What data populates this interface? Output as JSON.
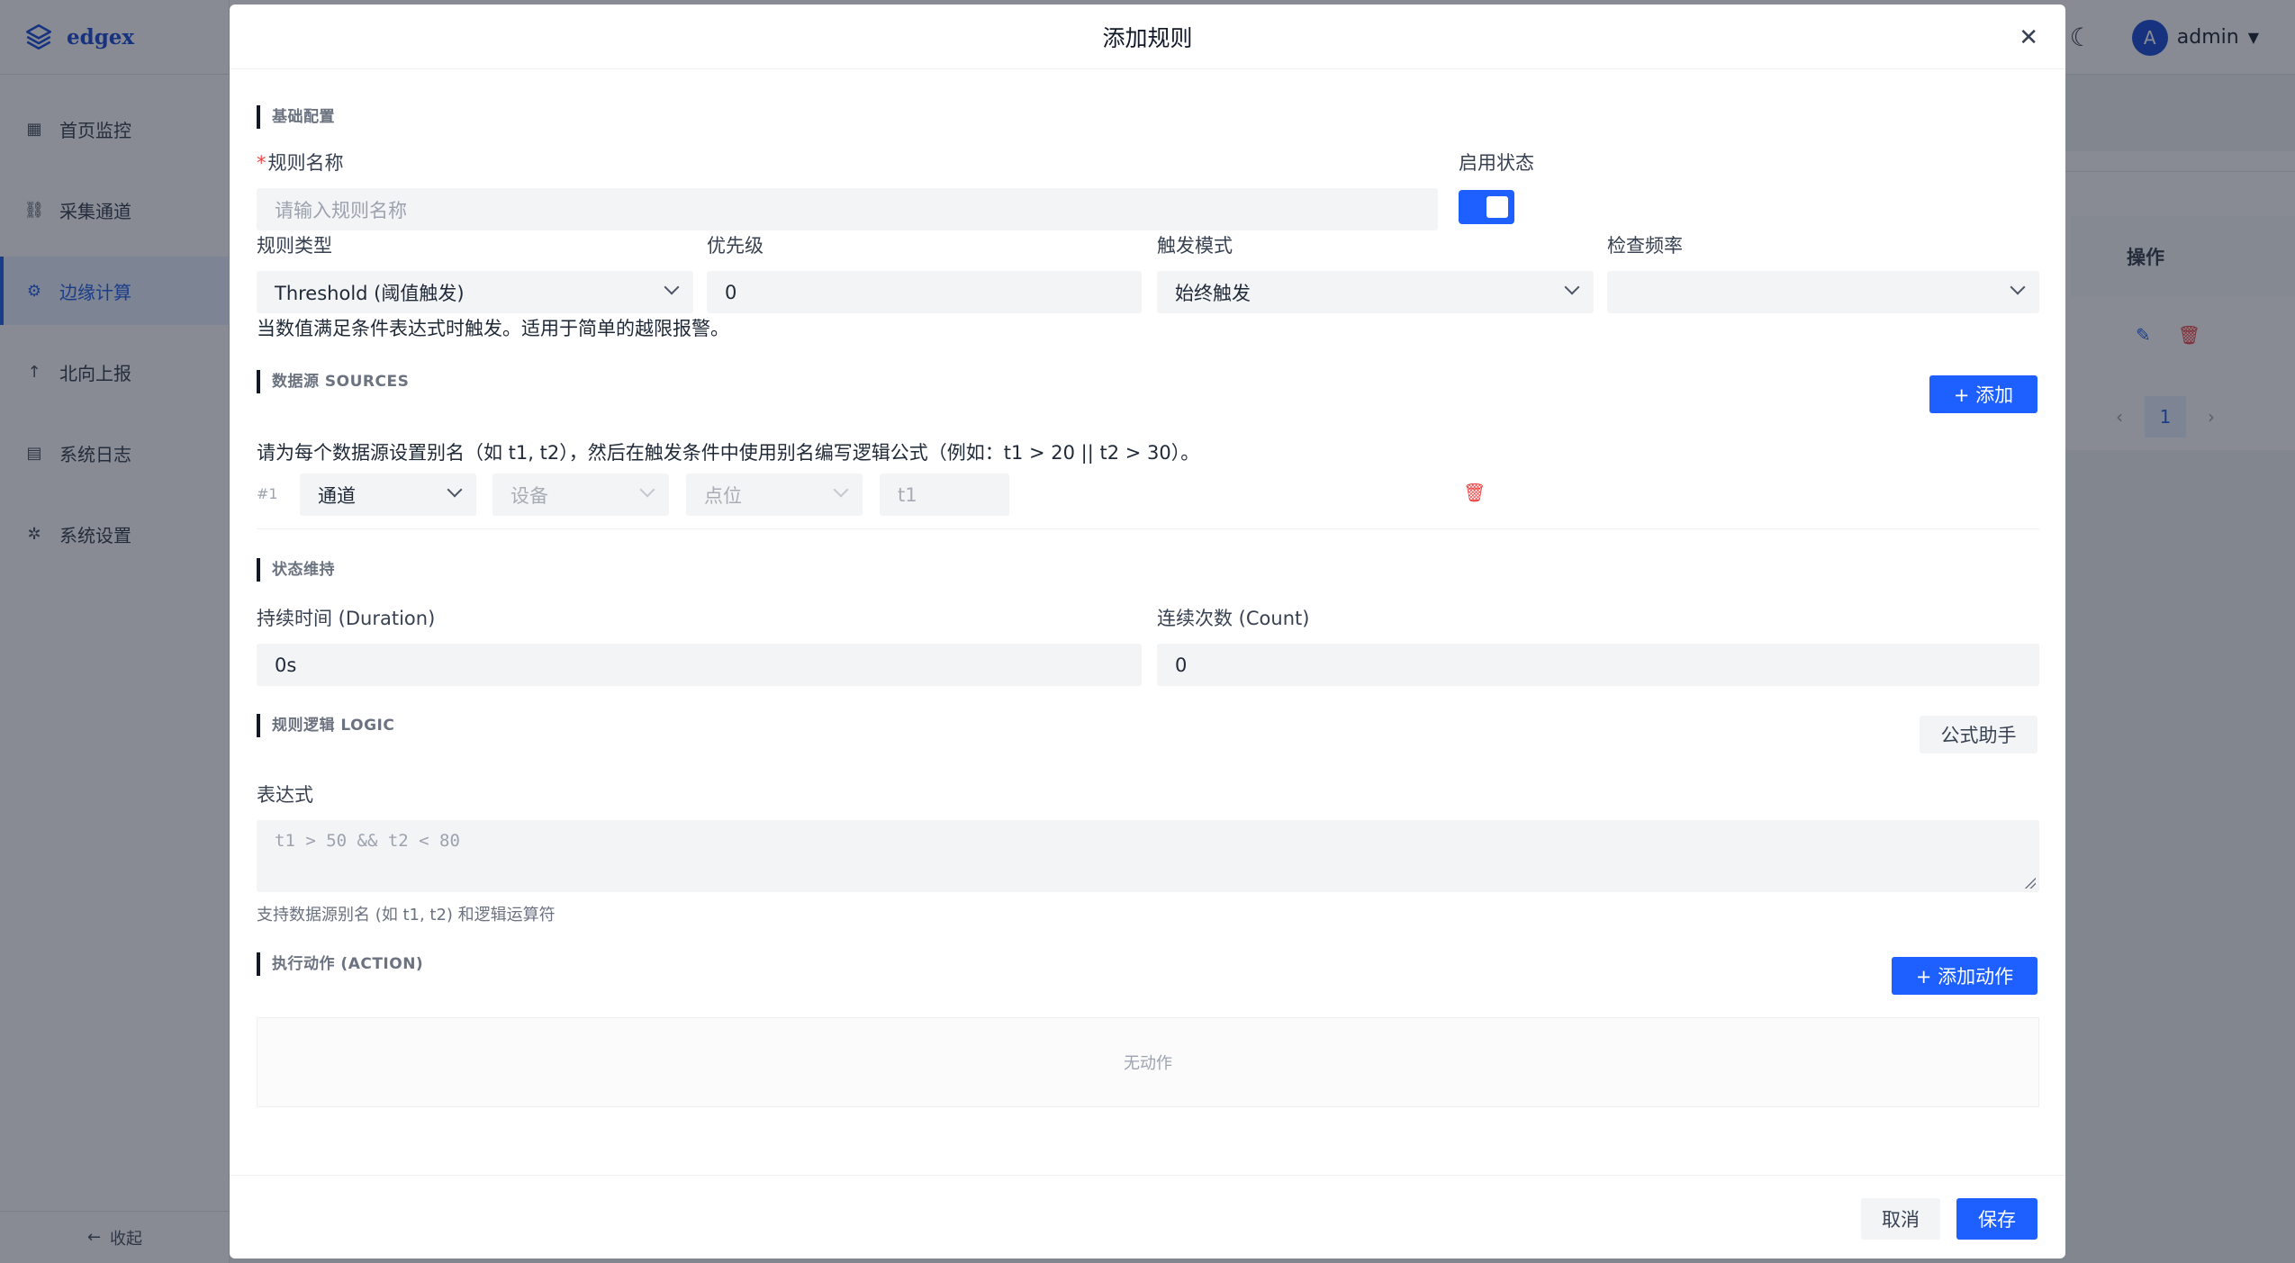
{
  "app": {
    "brand": "edgex",
    "nav": [
      {
        "label": "首页监控",
        "icon": "grid-icon"
      },
      {
        "label": "采集通道",
        "icon": "link-icon"
      },
      {
        "label": "边缘计算",
        "icon": "cpu-icon",
        "active": true
      },
      {
        "label": "北向上报",
        "icon": "arrow-up-icon"
      },
      {
        "label": "系统日志",
        "icon": "document-icon"
      },
      {
        "label": "系统设置",
        "icon": "gear-icon"
      }
    ],
    "collapse_label": "收起",
    "user": {
      "initial": "A",
      "name": "admin"
    },
    "table_header_action": "操作",
    "pager_page": "1"
  },
  "modal": {
    "title": "添加规则",
    "sections": {
      "basic": "基础配置",
      "sources": "数据源 SOURCES",
      "state": "状态维持",
      "logic": "规则逻辑 LOGIC",
      "action": "执行动作 (ACTION)"
    },
    "basic": {
      "name_label": "规则名称",
      "name_placeholder": "请输入规则名称",
      "enabled_label": "启用状态",
      "enabled": true,
      "type_label": "规则类型",
      "type_value": "Threshold (阈值触发)",
      "priority_label": "优先级",
      "priority_value": "0",
      "trigger_label": "触发模式",
      "trigger_value": "始终触发",
      "freq_label": "检查频率",
      "freq_value": "",
      "type_hint": "当数值满足条件表达式时触发。适用于简单的越限报警。"
    },
    "sources": {
      "add_label": "+ 添加",
      "hint": "请为每个数据源设置别名（如 t1, t2），然后在触发条件中使用别名编写逻辑公式（例如：t1 > 20 || t2 > 30）。",
      "rows": [
        {
          "index": "#1",
          "channel": "通道",
          "device": "设备",
          "point": "点位",
          "alias": "t1"
        }
      ]
    },
    "state": {
      "duration_label": "持续时间 (Duration)",
      "duration_value": "0s",
      "count_label": "连续次数 (Count)",
      "count_value": "0"
    },
    "logic": {
      "helper_label": "公式助手",
      "expr_label": "表达式",
      "expr_placeholder": "t1 > 50 && t2 < 80",
      "expr_hint": "支持数据源别名 (如 t1, t2) 和逻辑运算符"
    },
    "action": {
      "add_label": "+ 添加动作",
      "empty": "无动作"
    },
    "footer": {
      "cancel": "取消",
      "save": "保存"
    }
  }
}
